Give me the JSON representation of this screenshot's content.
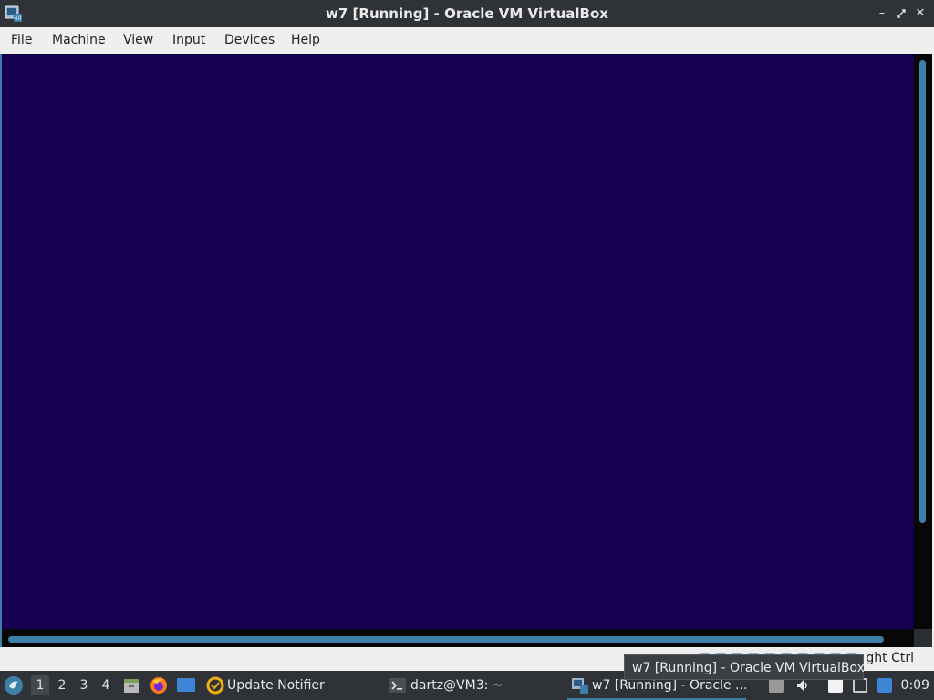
{
  "window": {
    "title": "w7 [Running] - Oracle VM VirtualBox",
    "controls": [
      "minimize",
      "restore",
      "close"
    ]
  },
  "menubar": {
    "items": [
      "File",
      "Machine",
      "View",
      "Input",
      "Devices",
      "Help"
    ]
  },
  "statusbar": {
    "host_key_text": "ght Ctrl"
  },
  "tooltip": {
    "text": "w7 [Running] - Oracle VM VirtualBox"
  },
  "taskbar": {
    "desktops": [
      "1",
      "2",
      "3",
      "4"
    ],
    "active_desktop": "1",
    "launchers": [
      "file-manager-icon",
      "firefox-icon",
      "desktop-icon"
    ],
    "tasks": [
      {
        "label": "Update Notifier",
        "icon": "update-notifier-icon"
      },
      {
        "label": "dartz@VM3: ~",
        "icon": "terminal-icon"
      },
      {
        "label": "w7 [Running] - Oracle ...",
        "icon": "virtualbox-icon"
      }
    ],
    "clock": "0:09"
  },
  "colors": {
    "vm_screen": "#15004f",
    "scrollbar_accent": "#3d7fa8",
    "panel_bg": "#2f3337",
    "menubar_bg": "#efefef"
  }
}
